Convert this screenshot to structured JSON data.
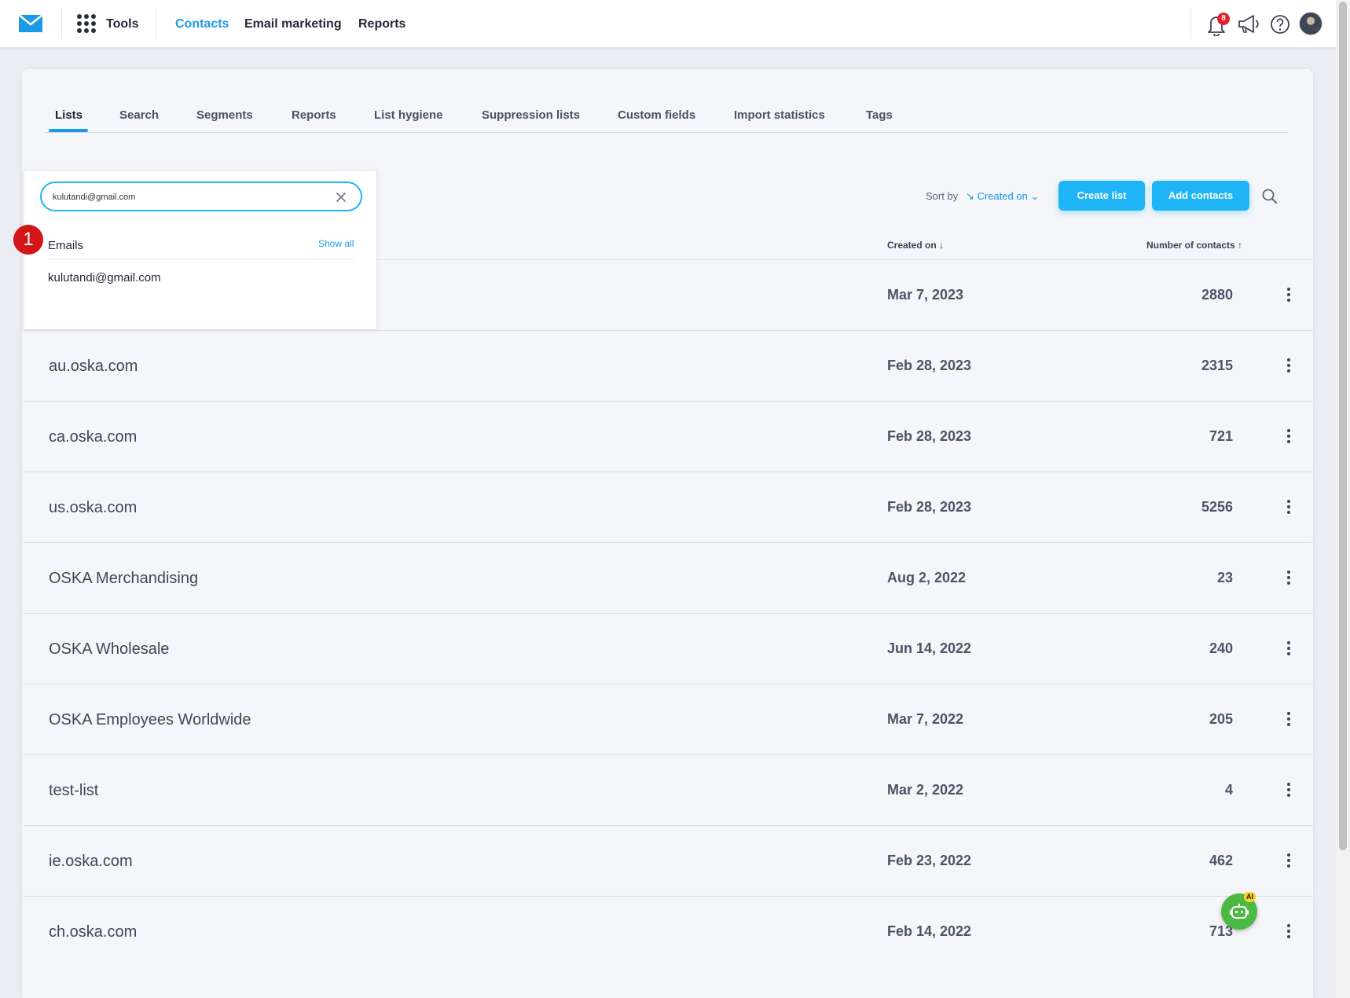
{
  "topbar": {
    "tools_label": "Tools",
    "nav": [
      "Contacts",
      "Email marketing",
      "Reports"
    ],
    "active_nav": "Contacts",
    "notifications_count": "8"
  },
  "tabs": [
    "Lists",
    "Search",
    "Segments",
    "Reports",
    "List hygiene",
    "Suppression lists",
    "Custom fields",
    "Import statistics",
    "Tags"
  ],
  "active_tab": "Lists",
  "toolbar": {
    "sort_by_label": "Sort by",
    "sort_by_value": "Created on",
    "create_list": "Create list",
    "add_contacts": "Add contacts"
  },
  "table": {
    "col_created": "Created on",
    "col_contacts": "Number of contacts",
    "rows": [
      {
        "name": "",
        "date": "Mar 7, 2023",
        "count": "2880"
      },
      {
        "name": "au.oska.com",
        "date": "Feb 28, 2023",
        "count": "2315"
      },
      {
        "name": "ca.oska.com",
        "date": "Feb 28, 2023",
        "count": "721"
      },
      {
        "name": "us.oska.com",
        "date": "Feb 28, 2023",
        "count": "5256"
      },
      {
        "name": "OSKA Merchandising",
        "date": "Aug 2, 2022",
        "count": "23"
      },
      {
        "name": "OSKA Wholesale",
        "date": "Jun 14, 2022",
        "count": "240"
      },
      {
        "name": "OSKA Employees Worldwide",
        "date": "Mar 7, 2022",
        "count": "205"
      },
      {
        "name": "test-list",
        "date": "Mar 2, 2022",
        "count": "4"
      },
      {
        "name": "ie.oska.com",
        "date": "Feb 23, 2022",
        "count": "462"
      },
      {
        "name": "ch.oska.com",
        "date": "Feb 14, 2022",
        "count": "713"
      }
    ]
  },
  "search_dropdown": {
    "query": "kulutandi@gmail.com",
    "section_heading": "Emails",
    "show_all": "Show all",
    "results": [
      "kulutandi@gmail.com"
    ]
  },
  "step_marker": "1",
  "ai_badge": "AI",
  "colors": {
    "accent": "#1a9ae6",
    "button": "#1fb4f6",
    "marker": "#d31518",
    "ai": "#4cb944"
  }
}
